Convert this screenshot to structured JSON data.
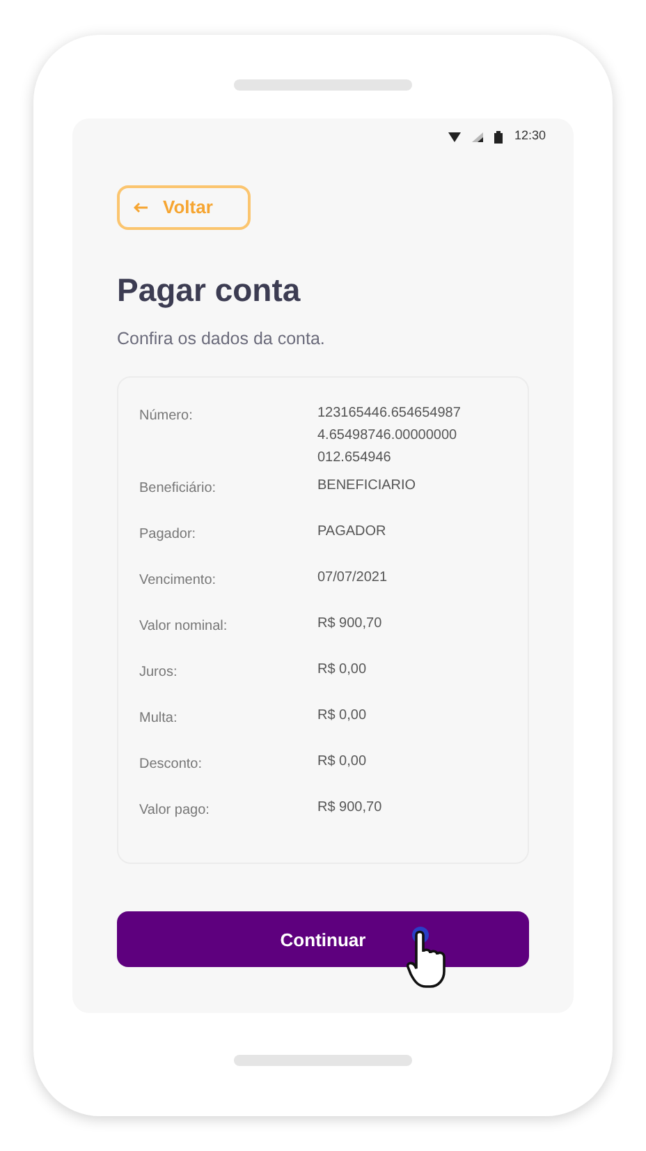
{
  "status_bar": {
    "time": "12:30"
  },
  "back_button": {
    "label": "Voltar"
  },
  "title": "Pagar conta",
  "subtitle": "Confira os dados da conta.",
  "details": [
    {
      "label": "Número:",
      "value": "123165446.6546549874.65498746.00000000012.654946"
    },
    {
      "label": "Beneficiário:",
      "value": "BENEFICIARIO"
    },
    {
      "label": "Pagador:",
      "value": "PAGADOR"
    },
    {
      "label": "Vencimento:",
      "value": "07/07/2021"
    },
    {
      "label": "Valor nominal:",
      "value": "R$ 900,70"
    },
    {
      "label": "Juros:",
      "value": "R$ 0,00"
    },
    {
      "label": "Multa:",
      "value": "R$ 0,00"
    },
    {
      "label": "Desconto:",
      "value": "R$ 0,00"
    },
    {
      "label": "Valor pago:",
      "value": "R$ 900,70"
    }
  ],
  "primary_button": {
    "label": "Continuar"
  }
}
